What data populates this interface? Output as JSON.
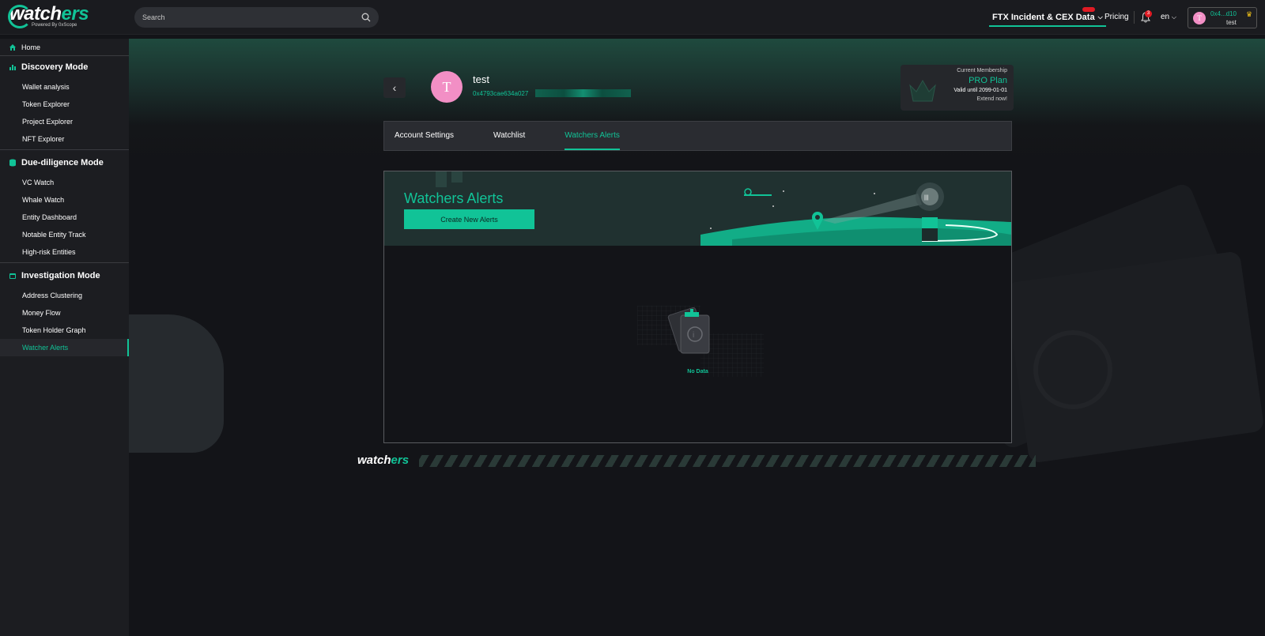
{
  "brand": {
    "logo_main": "watch",
    "logo_accent": "ers",
    "logo_sub": "Powered By 0xScope"
  },
  "topbar": {
    "search_placeholder": "Search",
    "ftx_label": "FTX Incident & CEX Data",
    "pricing": "Pricing",
    "notification_count": "3",
    "language": "en",
    "user_address": "0x4...d10",
    "user_name": "test",
    "user_initial": "T"
  },
  "sidebar": {
    "home": "Home",
    "sections": [
      {
        "title": "Discovery Mode",
        "items": [
          "Wallet analysis",
          "Token Explorer",
          "Project Explorer",
          "NFT Explorer"
        ]
      },
      {
        "title": "Due-diligence Mode",
        "items": [
          "VC Watch",
          "Whale Watch",
          "Entity Dashboard",
          "Notable Entity Track",
          "High-risk Entities"
        ]
      },
      {
        "title": "Investigation Mode",
        "items": [
          "Address Clustering",
          "Money Flow",
          "Token Holder Graph",
          "Watcher Alerts"
        ]
      }
    ],
    "active_item": "Watcher Alerts"
  },
  "profile": {
    "initial": "T",
    "name": "test",
    "address": "0x4793cae634a027"
  },
  "membership": {
    "label": "Current Membership",
    "plan": "PRO Plan",
    "valid": "Valid until 2099-01-01",
    "extend": "Extend now!"
  },
  "tabs": [
    {
      "label": "Account Settings",
      "active": false
    },
    {
      "label": "Watchlist",
      "active": false
    },
    {
      "label": "Watchers Alerts",
      "active": true
    }
  ],
  "alerts": {
    "title": "Watchers Alerts",
    "create_button": "Create New Alerts",
    "empty_text": "No Data"
  },
  "footer": {
    "logo_main": "watch",
    "logo_accent": "ers"
  },
  "colors": {
    "accent": "#11c397",
    "badge_red": "#e01b24",
    "avatar_pink": "#f28fc5"
  }
}
